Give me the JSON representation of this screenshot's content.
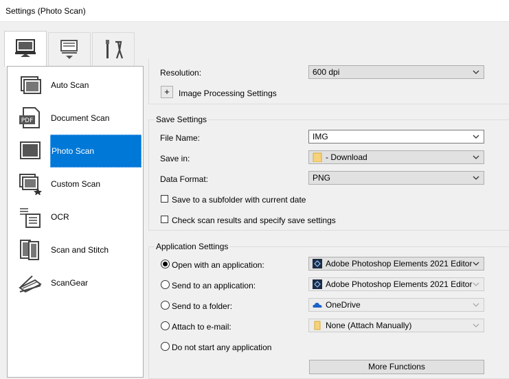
{
  "window": {
    "title": "Settings (Photo Scan)"
  },
  "tabs": [
    {
      "name": "scan-from-computer",
      "icon": "computer-scan-icon",
      "active": true
    },
    {
      "name": "scan-from-operation-panel",
      "icon": "scanner-down-icon",
      "active": false
    },
    {
      "name": "general-settings",
      "icon": "tools-icon",
      "active": false
    }
  ],
  "sidebar": {
    "items": [
      {
        "label": "Auto Scan",
        "icon": "auto-scan-icon"
      },
      {
        "label": "Document Scan",
        "icon": "pdf-document-icon",
        "icon_text": "PDF"
      },
      {
        "label": "Photo Scan",
        "icon": "photo-icon",
        "selected": true
      },
      {
        "label": "Custom Scan",
        "icon": "custom-scan-icon"
      },
      {
        "label": "OCR",
        "icon": "ocr-icon"
      },
      {
        "label": "Scan and Stitch",
        "icon": "stitch-icon"
      },
      {
        "label": "ScanGear",
        "icon": "scangear-icon"
      }
    ]
  },
  "scan_options": {
    "resolution_label": "Resolution:",
    "resolution_value": "600 dpi",
    "image_processing_label": "Image Processing Settings",
    "plus_label": "+"
  },
  "save_settings": {
    "title": "Save Settings",
    "file_name_label": "File Name:",
    "file_name_value": "IMG",
    "save_in_label": "Save in:",
    "save_in_value": "- Download",
    "data_format_label": "Data Format:",
    "data_format_value": "PNG",
    "subfolder_label": "Save to a subfolder with current date",
    "check_results_label": "Check scan results and specify save settings"
  },
  "application_settings": {
    "title": "Application Settings",
    "options": [
      {
        "label": "Open with an application:",
        "value": "Adobe Photoshop Elements 2021 Editor",
        "checked": true,
        "icon": "photoshop-elements-icon"
      },
      {
        "label": "Send to an application:",
        "value": "Adobe Photoshop Elements 2021 Editor",
        "checked": false,
        "icon": "photoshop-elements-icon"
      },
      {
        "label": "Send to a folder:",
        "value": "OneDrive",
        "checked": false,
        "icon": "onedrive-icon"
      },
      {
        "label": "Attach to e-mail:",
        "value": "None (Attach Manually)",
        "checked": false,
        "icon": "folder-icon"
      },
      {
        "label": "Do not start any application",
        "checked": false
      }
    ],
    "more_functions_label": "More Functions"
  },
  "colors": {
    "accent": "#0078d7",
    "panel_bg": "#f0f0f0",
    "field_bg": "#e1e1e1"
  }
}
